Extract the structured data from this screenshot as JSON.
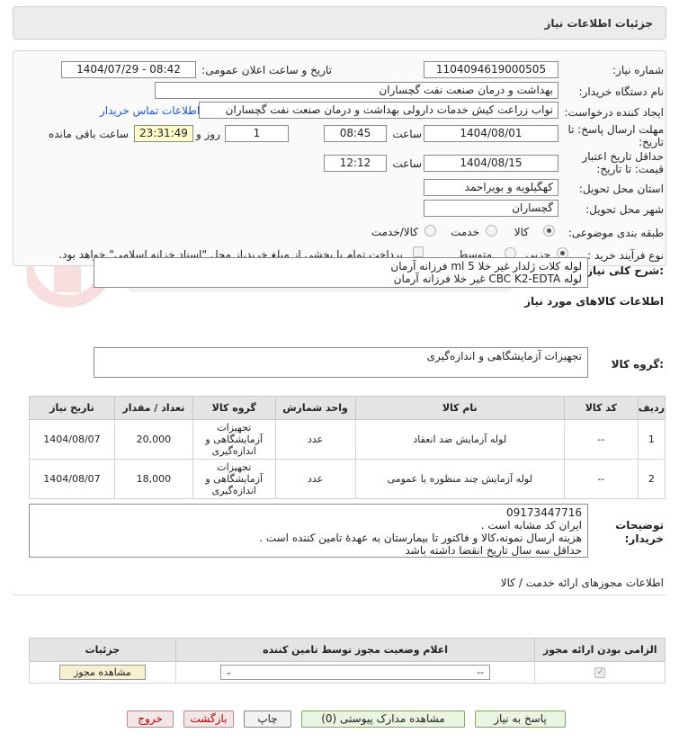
{
  "header": {
    "title": "جزئیات اطلاعات نیاز"
  },
  "form": {
    "need_number_label": "شماره نیاز:",
    "need_number": "1104094619000505",
    "announce_label": "تاریخ و ساعت اعلان عمومی:",
    "announce_value": "1404/07/29 - 08:42",
    "buyer_label": "نام دستگاه خریدار:",
    "buyer_value": "بهداشت و درمان صنعت نفت گچساران",
    "creator_label": "ایجاد کننده درخواست:",
    "creator_value": "نواب زراعت کیش خدمات دارولی بهداشت و درمان صنعت نفت گچساران",
    "contact_link": "اطلاعات تماس خریدار",
    "reply_deadline_label": "مهلت ارسال پاسخ: تا تاریخ:",
    "reply_date": "1404/08/01",
    "time_label": "ساعت",
    "reply_time": "08:45",
    "days_value": "1",
    "days_label": "روز و",
    "remaining_value": "23:31:49",
    "remaining_label": "ساعت باقی مانده",
    "validity_label": "حداقل تاریخ اعتبار قیمت: تا تاریخ:",
    "validity_date": "1404/08/15",
    "validity_time": "12:12",
    "province_label": "استان محل تحویل:",
    "province_value": "کهگیلویه و بویراحمد",
    "city_label": "شهر محل تحویل:",
    "city_value": "گچساران",
    "category_label": "طبقه بندی موضوعی:",
    "category_options": [
      "کالا",
      "خدمت",
      "کالا/خدمت"
    ],
    "purchase_label": "نوع فرآیند خرید :",
    "purchase_options": [
      "جزیی",
      "متوسط"
    ],
    "payment_note": "پرداخت تمام یا بخشی از مبلغ خرید،از محل \"اسناد خزانه اسلامی\" خواهد بود."
  },
  "summary": {
    "label": "شرح کلی نیاز:",
    "line1": "لوله کلات ژلدار غیر خلا ml 5  فرزانه آرمان",
    "line2": "لوله CBC K2-EDTA غیر خلا فرزانه آرمان"
  },
  "goods": {
    "section_title": "اطلاعات کالاهای مورد نیاز",
    "group_label": "گروه کالا:",
    "group_value": "تجهیزات آزمایشگاهی و اندازه‌گیری",
    "columns": [
      "ردیف",
      "کد کالا",
      "نام کالا",
      "واحد شمارش",
      "گروه کالا",
      "تعداد / مقدار",
      "تاریخ نیاز"
    ],
    "rows": [
      {
        "idx": "1",
        "code": "--",
        "name": "لوله آزمایش ضد انعقاد",
        "unit": "عدد",
        "group": "تجهیزات آزمایشگاهی و اندازه‌گیری",
        "qty": "20,000",
        "date": "1404/08/07"
      },
      {
        "idx": "2",
        "code": "--",
        "name": "لوله آزمایش چند منظوره یا عمومی",
        "unit": "عدد",
        "group": "تجهیزات آزمایشگاهی و اندازه‌گیری",
        "qty": "18,000",
        "date": "1404/08/07"
      }
    ]
  },
  "notes": {
    "label": "توضیحات خریدار:",
    "line1": "09173447716",
    "line2": "ایران کد مشابه است .",
    "line3": "هزینه ارسال نمونه،کالا و فاکتور تا بیمارستان به عهدهٔ تامین کننده است .",
    "line4": "حداقل سه سال تاریخ انقضا داشته باشد"
  },
  "permits": {
    "title": "اطلاعات مجوزهای ارائه خدمت / کالا",
    "col_required": "الزامی بودن ارائه مجوز",
    "col_status": "اعلام وضعیت مجوز توسط تامین کننده",
    "col_details": "جزئیات",
    "select_value": "--",
    "view_button": "مشاهده مجوز"
  },
  "actions": {
    "reply": "پاسخ به نیاز",
    "docs": "مشاهده مدارک پیوستی (0)",
    "print": "چاپ",
    "back": "بازگشت",
    "exit": "خروج"
  }
}
